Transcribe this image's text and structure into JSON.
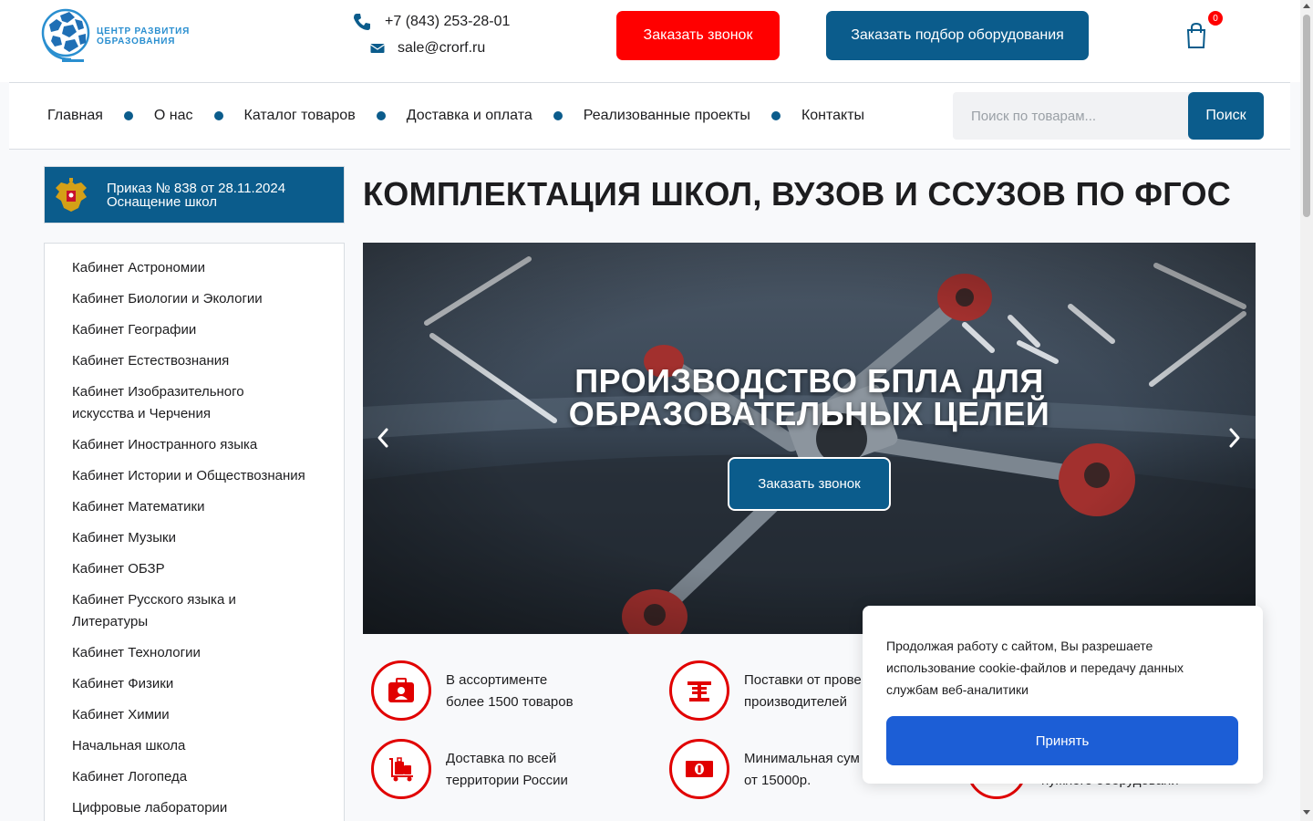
{
  "header": {
    "logo_text_line1": "ЦЕНТР РАЗВИТИЯ",
    "logo_text_line2": "ОБРАЗОВАНИЯ",
    "phone": "+7 (843) 253-28-01",
    "email": "sale@crorf.ru",
    "call_button": "Заказать звонок",
    "pick_button": "Заказать подбор оборудования",
    "cart_count": "0"
  },
  "nav": {
    "items": [
      "Главная",
      "О нас",
      "Каталог товаров",
      "Доставка и оплата",
      "Реализованные проекты",
      "Контакты"
    ],
    "search_placeholder": "Поиск по товарам...",
    "search_button": "Поиск"
  },
  "sidebar": {
    "order_line1": "Приказ № 838 от 28.11.2024",
    "order_line2": "Оснащение школ",
    "categories": [
      "Кабинет Астрономии",
      "Кабинет Биологии и Экологии",
      "Кабинет Географии",
      "Кабинет Естествознания",
      "Кабинет Изобразительного искусства и Черчения",
      "Кабинет Иностранного языка",
      "Кабинет Истории и Обществознания",
      "Кабинет Математики",
      "Кабинет Музыки",
      "Кабинет ОБЗР",
      "Кабинет Русского языка и Литературы",
      "Кабинет Технологии",
      "Кабинет Физики",
      "Кабинет Химии",
      "Начальная школа",
      "Кабинет Логопеда",
      "Цифровые лаборатории"
    ]
  },
  "main": {
    "title": "КОМПЛЕКТАЦИЯ ШКОЛ, ВУЗОВ И ССУЗОВ ПО ФГОС",
    "slide_title_line1": "ПРОИЗВОДСТВО БПЛА ДЛЯ",
    "slide_title_line2": "ОБРАЗОВАТЕЛЬНЫХ ЦЕЛЕЙ",
    "slide_button": "Заказать звонок",
    "features": [
      {
        "line1": "В ассортименте",
        "line2": "более 1500 товаров",
        "icon": "id-badge-icon"
      },
      {
        "line1": "Поставки от прове",
        "line2": "производителей",
        "icon": "factory-icon"
      },
      {
        "line1": "Доставка по всей",
        "line2": "территории России",
        "icon": "luggage-cart-icon"
      },
      {
        "line1": "Минимальная сум",
        "line2": "от 15000р.",
        "icon": "money-bill-icon"
      },
      {
        "line1": "",
        "line2": "нужного оборудовани",
        "icon": "partial-icon"
      }
    ]
  },
  "cookie": {
    "text": "Продолжая работу с сайтом, Вы разрешаете использование cookie-файлов и передачу данных службам веб-аналитики",
    "accept": "Принять"
  },
  "colors": {
    "brand_blue": "#0b5c8c",
    "accent_red": "#ff0000",
    "cookie_blue": "#1c5ed6"
  }
}
